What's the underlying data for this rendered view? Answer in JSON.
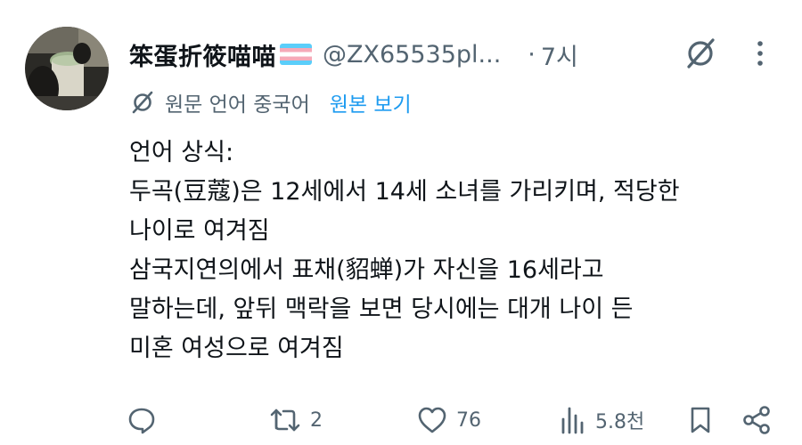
{
  "post": {
    "author": {
      "display_name": "笨蛋折筱喵喵",
      "flag_icon": "transgender-flag-icon",
      "handle": "@ZX65535pl...",
      "separator": "·",
      "time": "7시"
    },
    "translation": {
      "label": "원문 언어 중국어",
      "show_original": "원본 보기"
    },
    "body_lines": [
      "언어 상식:",
      "두곡(豆蔻)은 12세에서 14세 소녀를 가리키며, 적당한",
      "나이로 여겨짐",
      "삼국지연의에서 표채(貂蝉)가 자신을 16세라고",
      "말하는데, 앞뒤 맥락을 보면 당시에는 대개 나이 든",
      "미혼 여성으로 여겨짐"
    ],
    "actions": {
      "reply_icon": "reply-icon",
      "repost_icon": "repost-icon",
      "repost_count": "2",
      "like_icon": "heart-icon",
      "like_count": "76",
      "views_icon": "views-icon",
      "views_count": "5.8천",
      "bookmark_icon": "bookmark-icon",
      "share_icon": "share-icon"
    }
  },
  "colors": {
    "text_primary": "#0f1419",
    "text_secondary": "#536471",
    "link": "#1d9bf0",
    "flag_blue": "#5bcefa",
    "flag_pink": "#f5a9b8",
    "flag_white": "#ffffff"
  }
}
